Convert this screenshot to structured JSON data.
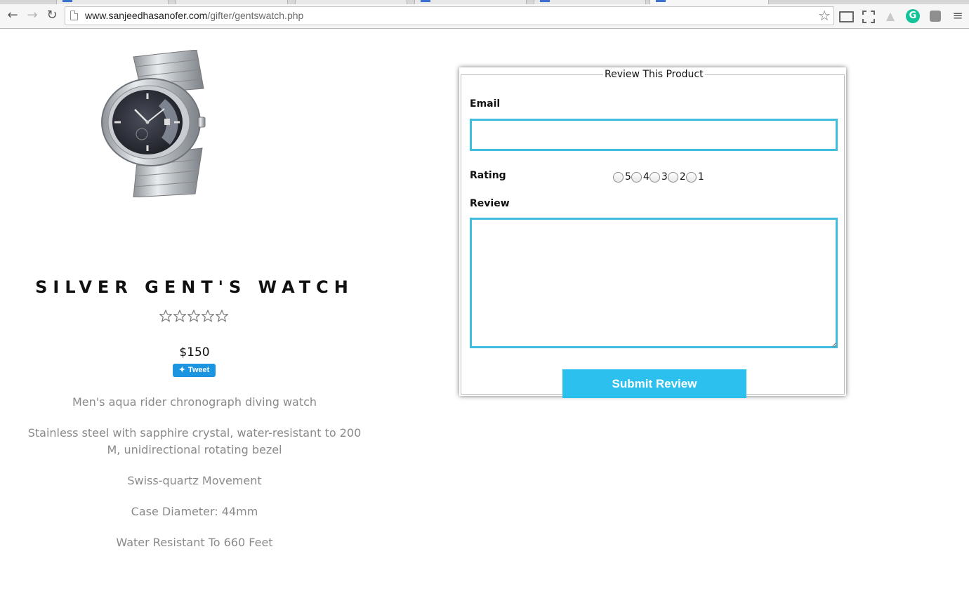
{
  "browser": {
    "url_host": "www.sanjeedhasanofer.com",
    "url_path": "/gifter/gentswatch.php",
    "nav_back_icon": "back-arrow-icon",
    "nav_forward_icon": "forward-arrow-icon",
    "reload_icon": "reload-icon",
    "bookmark_icon": "star-icon",
    "extensions": [
      "cast-icon",
      "screenshot-icon",
      "drive-icon",
      "grammarly-icon",
      "extension-icon",
      "menu-icon"
    ]
  },
  "product": {
    "image_alt": "silver-watch-image",
    "title": "SILVER GENT'S WATCH",
    "rating_stars": 5,
    "rating_filled": 0,
    "price": "$150",
    "tweet_label": "Tweet",
    "features": [
      "Men's aqua rider chronograph diving watch",
      "Stainless steel with sapphire crystal, water-resistant to 200 M, unidirectional rotating bezel",
      "Swiss-quartz Movement",
      "Case Diameter: 44mm",
      "Water Resistant To 660 Feet"
    ]
  },
  "review_form": {
    "legend": "Review This Product",
    "email_label": "Email",
    "email_value": "",
    "rating_label": "Rating",
    "rating_options": [
      "5",
      "4",
      "3",
      "2",
      "1"
    ],
    "review_label": "Review",
    "review_value": "",
    "submit_label": "Submit Review"
  },
  "colors": {
    "input_border": "#3fbcde",
    "submit_bg": "#2cc0ef",
    "tweet_bg": "#1b95e0",
    "feature_text": "#8a8a8a"
  }
}
